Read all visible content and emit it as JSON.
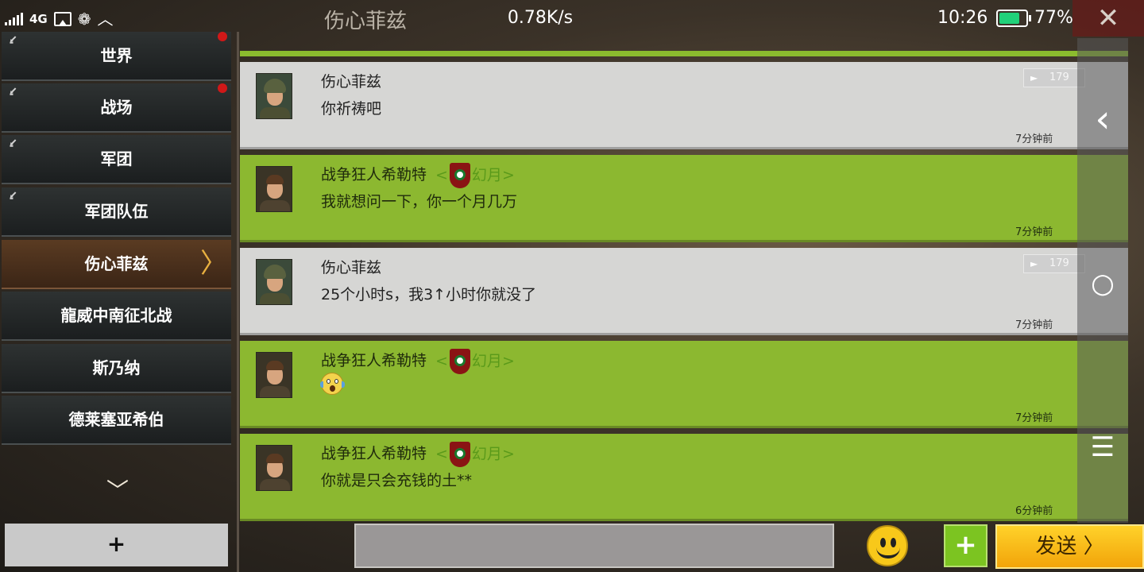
{
  "statusbar": {
    "network": "4G",
    "app_title": "伤心菲兹",
    "speed": "0.78K/s",
    "time": "10:26",
    "battery_pct": "77%",
    "battery_level": 0.77,
    "battery_color": "#21d17a"
  },
  "window": {
    "close_label": "✕"
  },
  "sidebar": {
    "items": [
      {
        "label": "世界",
        "pinned": true,
        "unread": true
      },
      {
        "label": "战场",
        "pinned": true,
        "unread": true
      },
      {
        "label": "军团",
        "pinned": true,
        "unread": false
      },
      {
        "label": "军团队伍",
        "pinned": true,
        "unread": false
      },
      {
        "label": "伤心菲兹",
        "pinned": false,
        "unread": false,
        "active": true
      },
      {
        "label": "龍威中南征北战",
        "pinned": false,
        "unread": false
      },
      {
        "label": "斯乃纳",
        "pinned": false,
        "unread": false
      },
      {
        "label": "德莱塞亚希伯",
        "pinned": false,
        "unread": false
      }
    ],
    "pin_glyph": "⭹",
    "active_arrow": "〉",
    "scroll_down": "﹀",
    "add_label": "+"
  },
  "messages": [
    {
      "sender": "伤心菲兹",
      "text": "你祈祷吧",
      "time": "7分钟前",
      "style": "grey",
      "level": "179",
      "avatar": "helmet"
    },
    {
      "sender": "战争狂人希勒特",
      "tag_open": "<",
      "tag_name": "幻月",
      "tag_close": ">",
      "text": "我就想问一下，你一个月几万",
      "time": "7分钟前",
      "style": "green",
      "avatar": "officer"
    },
    {
      "sender": "伤心菲兹",
      "text": "25个小时s，我3↑小时你就没了",
      "time": "7分钟前",
      "style": "grey",
      "level": "179",
      "avatar": "helmet"
    },
    {
      "sender": "战争狂人希勒特",
      "tag_open": "<",
      "tag_name": "幻月",
      "tag_close": ">",
      "text": "",
      "emoji": "scream",
      "time": "7分钟前",
      "style": "green",
      "avatar": "officer"
    },
    {
      "sender": "战争狂人希勒特",
      "tag_open": "<",
      "tag_name": "幻月",
      "tag_close": ">",
      "text": "你就是只会充钱的土**",
      "time": "6分钟前",
      "style": "green",
      "avatar": "officer"
    }
  ],
  "rightbar": {
    "back": "‹",
    "home": "○",
    "menu": "☰"
  },
  "composer": {
    "placeholder": "",
    "plus": "+",
    "send_label": "发送",
    "send_arrow": "〉",
    "emoji_icon": "smiley-icon"
  },
  "colors": {
    "grey_msg": "#d6d6d4",
    "green_msg": "#8cb830",
    "guild_tag": "#5a9a1a",
    "send": "#ffd22a"
  }
}
